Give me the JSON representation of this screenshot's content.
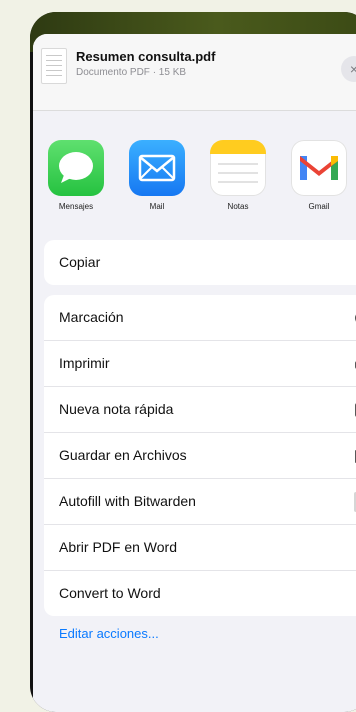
{
  "share_header": {
    "file_name": "Resumen consulta.pdf",
    "file_info": "Documento PDF · 15 KB",
    "close_glyph": "×"
  },
  "apps": [
    {
      "label": "Mensajes",
      "icon": "messages-icon"
    },
    {
      "label": "Mail",
      "icon": "mail-icon"
    },
    {
      "label": "Notas",
      "icon": "notes-icon"
    },
    {
      "label": "Gmail",
      "icon": "gmail-icon"
    }
  ],
  "action_groups": {
    "group1": [
      {
        "label": "Copiar",
        "icon": "copy-icon"
      }
    ],
    "group2": [
      {
        "label": "Marcación",
        "icon": "markup-icon"
      },
      {
        "label": "Imprimir",
        "icon": "printer-icon"
      },
      {
        "label": "Nueva nota rápida",
        "icon": "quick-note-icon"
      },
      {
        "label": "Guardar en Archivos",
        "icon": "folder-icon"
      },
      {
        "label": "Autofill with Bitwarden",
        "icon": "bitwarden-shield-icon"
      },
      {
        "label": "Abrir PDF en Word",
        "icon": "word-icon"
      },
      {
        "label": "Convert to Word",
        "icon": "word-icon"
      }
    ]
  },
  "edit_actions": "Editar acciones...",
  "colors": {
    "accent": "#0a7aff",
    "sheet_bg": "#f2f2f7",
    "messages_green": "#25c240",
    "mail_blue": "#1678f2"
  }
}
